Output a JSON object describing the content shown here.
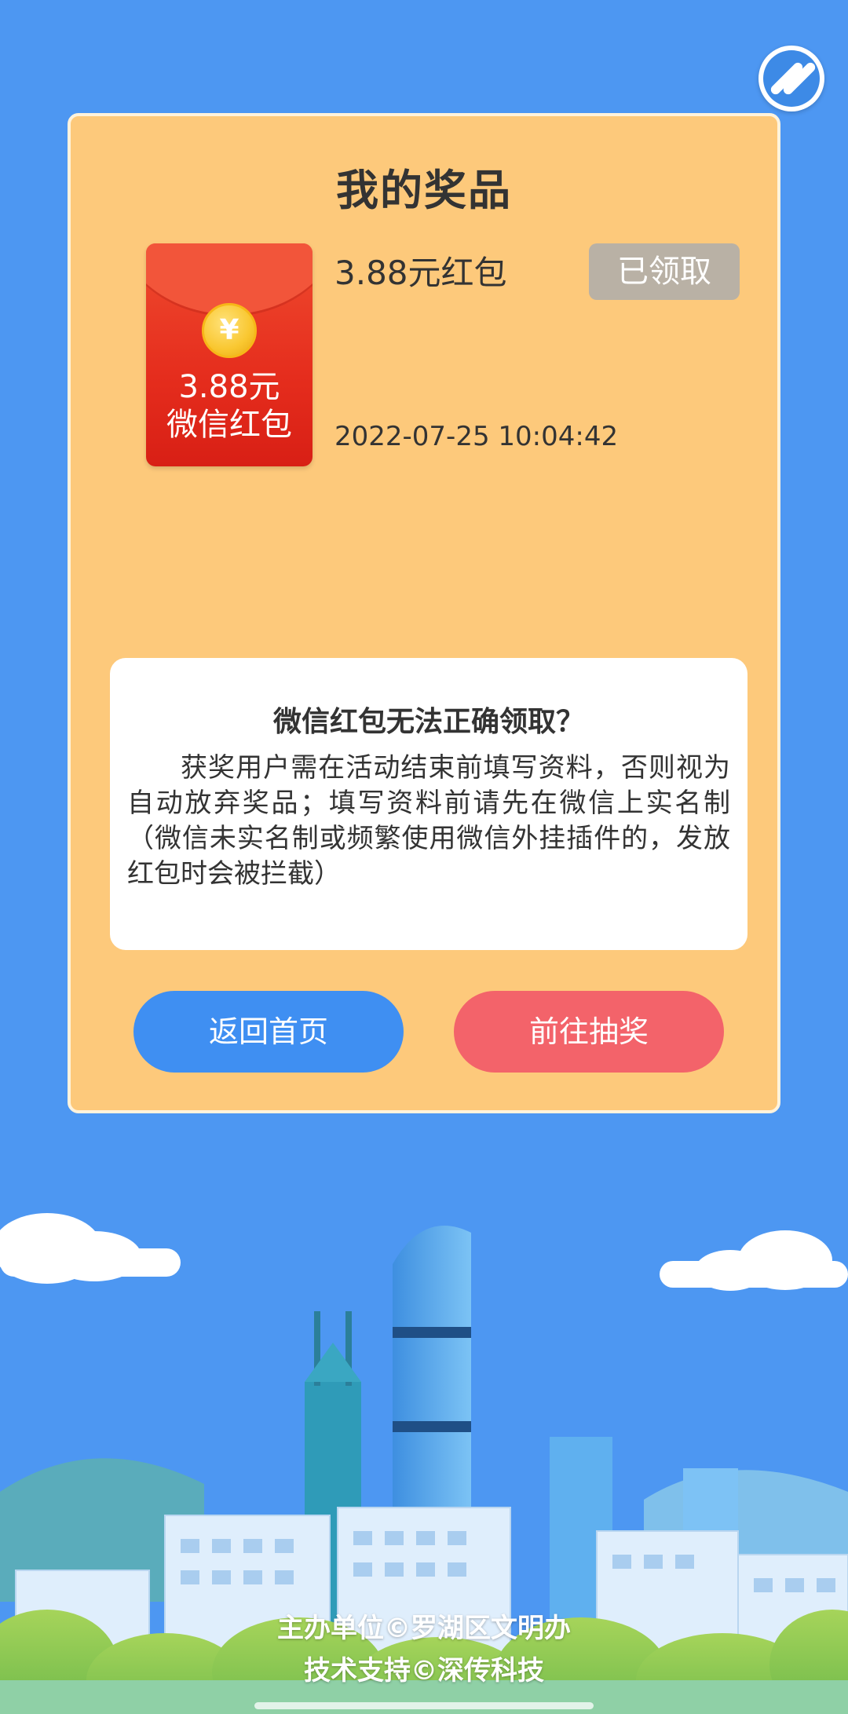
{
  "panel": {
    "title": "我的奖品"
  },
  "prize": {
    "packet_amount": "3.88元",
    "packet_label": "微信红包",
    "coin_symbol": "¥",
    "name": "3.88元红包",
    "time": "2022-07-25 10:04:42",
    "status": "已领取"
  },
  "info": {
    "title": "微信红包无法正确领取？",
    "body": "获奖用户需在活动结束前填写资料，否则视为自动放弃奖品；填写资料前请先在微信上实名制（微信未实名制或频繁使用微信外挂插件的，发放红包时会被拦截）"
  },
  "buttons": {
    "home": "返回首页",
    "draw": "前往抽奖"
  },
  "footer": {
    "organizer": "主办单位©罗湖区文明办",
    "support": "技术支持©深传科技"
  },
  "icons": {
    "sound": "music-toggle-icon",
    "coin": "yuan-coin-icon"
  },
  "colors": {
    "background": "#4d97f2",
    "panel": "#fdc97b",
    "home_button": "#3f8ff2",
    "draw_button": "#f3636a",
    "badge": "#b9b1a5"
  }
}
